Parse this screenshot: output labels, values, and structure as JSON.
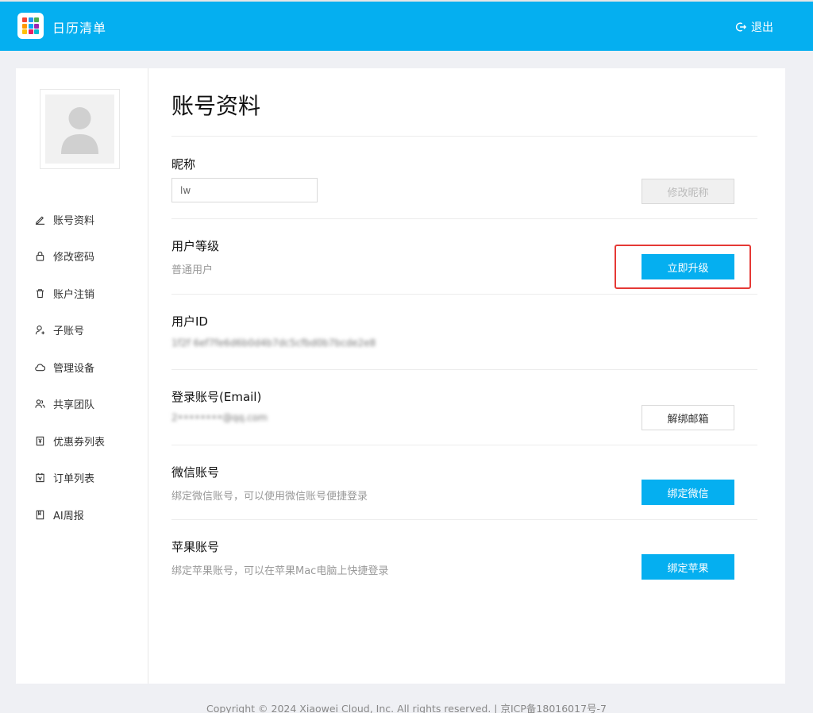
{
  "header": {
    "app_title": "日历清单",
    "logout_label": "退出",
    "logo_colors": [
      "#f44336",
      "#2196f3",
      "#4caf50",
      "#ff9800",
      "#03a9f4",
      "#9c27b0",
      "#ffc107",
      "#e91e63",
      "#00bcd4"
    ]
  },
  "sidebar": {
    "items": [
      {
        "label": "账号资料",
        "icon": "pencil-icon"
      },
      {
        "label": "修改密码",
        "icon": "lock-icon"
      },
      {
        "label": "账户注销",
        "icon": "trash-icon"
      },
      {
        "label": "子账号",
        "icon": "sub-account-icon"
      },
      {
        "label": "管理设备",
        "icon": "cloud-icon"
      },
      {
        "label": "共享团队",
        "icon": "team-icon"
      },
      {
        "label": "优惠券列表",
        "icon": "coupon-icon"
      },
      {
        "label": "订单列表",
        "icon": "order-icon"
      },
      {
        "label": "AI周报",
        "icon": "report-icon"
      }
    ]
  },
  "main": {
    "title": "账号资料",
    "nickname": {
      "label": "昵称",
      "value": "lw",
      "button": "修改昵称"
    },
    "level": {
      "label": "用户等级",
      "value": "普通用户",
      "button": "立即升级"
    },
    "user_id": {
      "label": "用户ID",
      "value": "1f2f 6ef7fe6d6b0d4b7dc5cfbd0b7bcde2e8"
    },
    "login": {
      "label": "登录账号(Email)",
      "value": "2••••••••@qq.com",
      "button": "解绑邮箱"
    },
    "wechat": {
      "label": "微信账号",
      "desc": "绑定微信账号，可以使用微信账号便捷登录",
      "button": "绑定微信"
    },
    "apple": {
      "label": "苹果账号",
      "desc": "绑定苹果账号，可以在苹果Mac电脑上快捷登录",
      "button": "绑定苹果"
    }
  },
  "footer": {
    "text": "Copyright © 2024 Xiaowei Cloud, Inc. All rights reserved. | 京ICP备18016017号-7"
  },
  "colors": {
    "brand": "#05aff0",
    "highlight": "#e53935"
  }
}
